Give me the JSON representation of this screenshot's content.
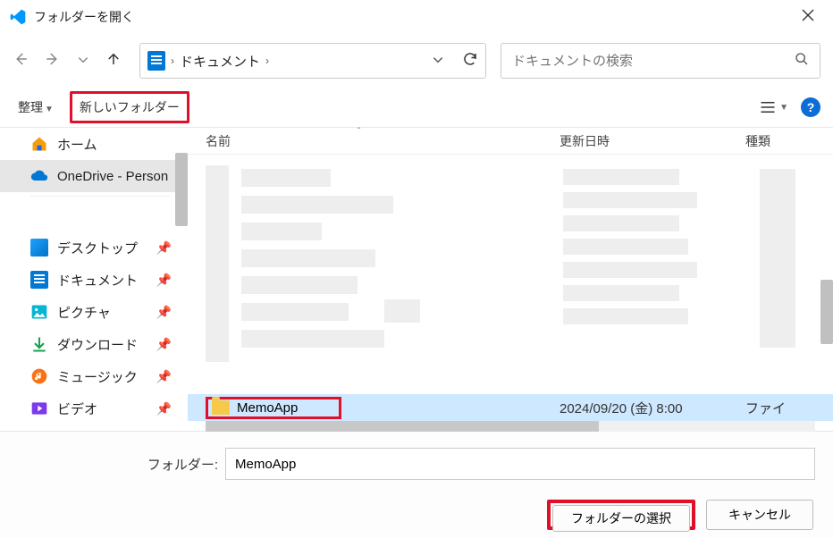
{
  "titlebar": {
    "title": "フォルダーを開く"
  },
  "address": {
    "crumb": "ドキュメント"
  },
  "search": {
    "placeholder": "ドキュメントの検索"
  },
  "toolbar": {
    "organize": "整理",
    "new_folder": "新しいフォルダー"
  },
  "sidebar": {
    "home": "ホーム",
    "onedrive": "OneDrive - Person",
    "desktop": "デスクトップ",
    "documents": "ドキュメント",
    "pictures": "ピクチャ",
    "downloads": "ダウンロード",
    "music": "ミュージック",
    "videos": "ビデオ"
  },
  "columns": {
    "name": "名前",
    "date": "更新日時",
    "type": "種類"
  },
  "row": {
    "name": "MemoApp",
    "date": "2024/09/20 (金) 8:00",
    "type": "ファイ"
  },
  "footer": {
    "folder_label": "フォルダー:",
    "folder_value": "MemoApp",
    "select_btn": "フォルダーの選択",
    "cancel_btn": "キャンセル"
  }
}
